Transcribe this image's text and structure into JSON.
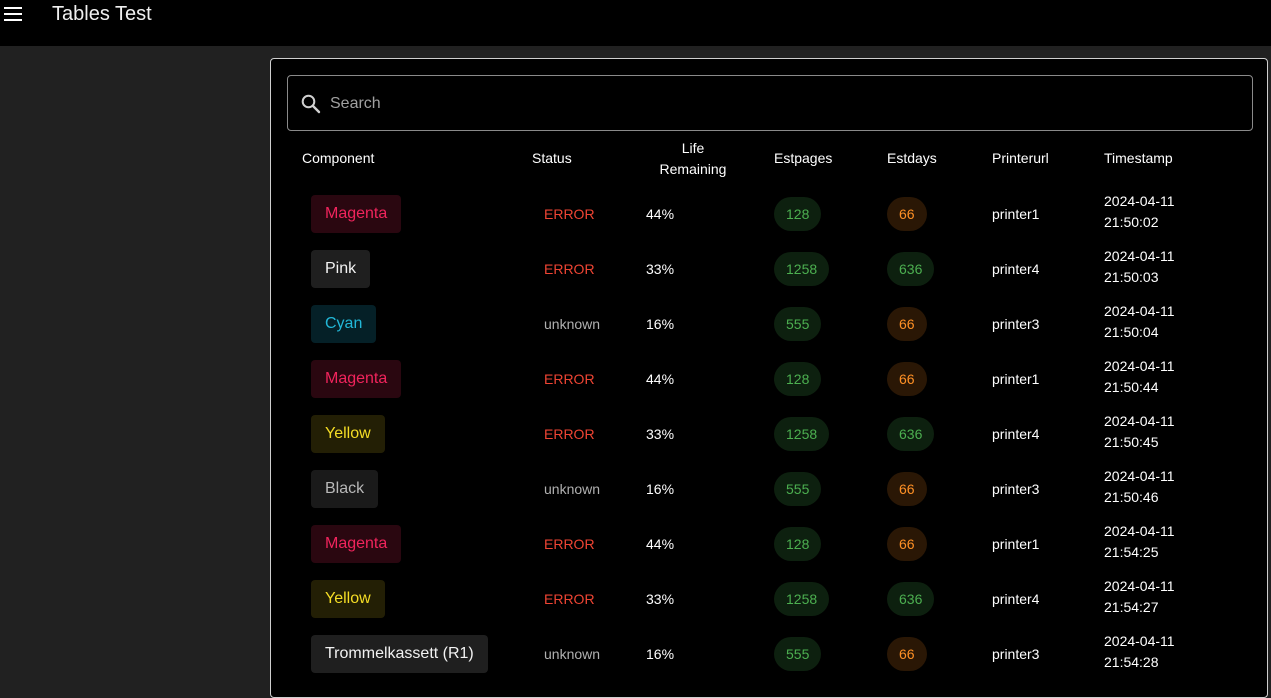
{
  "app": {
    "title": "Tables Test",
    "menu_icon": "menu-icon"
  },
  "search": {
    "placeholder": "Search",
    "value": "",
    "icon": "search-icon"
  },
  "table": {
    "columns": {
      "component": "Component",
      "status": "Status",
      "life_line1": "Life",
      "life_line2": "Remaining",
      "estpages": "Estpages",
      "estdays": "Estdays",
      "printerurl": "Printerurl",
      "timestamp": "Timestamp"
    },
    "rows": [
      {
        "component": "Magenta",
        "status": "ERROR",
        "life": "44%",
        "estpages": "128",
        "estdays": "66",
        "printerurl": "printer1",
        "date": "2024-04-11",
        "time": "21:50:02"
      },
      {
        "component": "Pink",
        "status": "ERROR",
        "life": "33%",
        "estpages": "1258",
        "estdays": "636",
        "printerurl": "printer4",
        "date": "2024-04-11",
        "time": "21:50:03"
      },
      {
        "component": "Cyan",
        "status": "unknown",
        "life": "16%",
        "estpages": "555",
        "estdays": "66",
        "printerurl": "printer3",
        "date": "2024-04-11",
        "time": "21:50:04"
      },
      {
        "component": "Magenta",
        "status": "ERROR",
        "life": "44%",
        "estpages": "128",
        "estdays": "66",
        "printerurl": "printer1",
        "date": "2024-04-11",
        "time": "21:50:44"
      },
      {
        "component": "Yellow",
        "status": "ERROR",
        "life": "33%",
        "estpages": "1258",
        "estdays": "636",
        "printerurl": "printer4",
        "date": "2024-04-11",
        "time": "21:50:45"
      },
      {
        "component": "Black",
        "status": "unknown",
        "life": "16%",
        "estpages": "555",
        "estdays": "66",
        "printerurl": "printer3",
        "date": "2024-04-11",
        "time": "21:50:46"
      },
      {
        "component": "Magenta",
        "status": "ERROR",
        "life": "44%",
        "estpages": "128",
        "estdays": "66",
        "printerurl": "printer1",
        "date": "2024-04-11",
        "time": "21:54:25"
      },
      {
        "component": "Yellow",
        "status": "ERROR",
        "life": "33%",
        "estpages": "1258",
        "estdays": "636",
        "printerurl": "printer4",
        "date": "2024-04-11",
        "time": "21:54:27"
      },
      {
        "component": "Trommelkassett (R1)",
        "status": "unknown",
        "life": "16%",
        "estpages": "555",
        "estdays": "66",
        "printerurl": "printer3",
        "date": "2024-04-11",
        "time": "21:54:28"
      }
    ]
  },
  "colors": {
    "chip": {
      "Magenta": {
        "fg": "#f0245c",
        "bg": "#2a0710"
      },
      "Pink": {
        "fg": "#f2f2f2",
        "bg": "#1f1f1f"
      },
      "Cyan": {
        "fg": "#22b8d8",
        "bg": "#052027"
      },
      "Yellow": {
        "fg": "#f5dd25",
        "bg": "#231f05"
      },
      "Black": {
        "fg": "#b8b8b8",
        "bg": "#1a1a1a"
      },
      "Trommelkassett (R1)": {
        "fg": "#f2f2f2",
        "bg": "#1f1f1f"
      }
    },
    "status": {
      "ERROR": "#ee4433",
      "unknown": "#b0b0b0"
    },
    "pill_green": {
      "fg": "#4caf50",
      "bg": "#0d200f"
    },
    "pill_orange": {
      "fg": "#ff9025",
      "bg": "#2a1705"
    }
  }
}
